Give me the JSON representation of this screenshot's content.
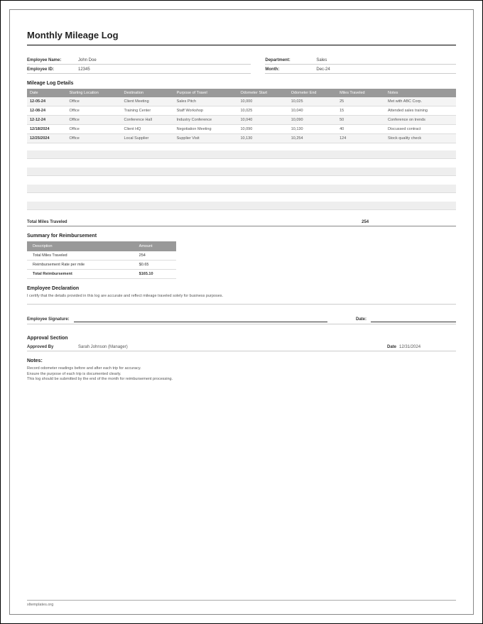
{
  "title": "Monthly Mileage Log",
  "info": {
    "employee_name_label": "Employee Name:",
    "employee_name": "John Doe",
    "department_label": "Department:",
    "department": "Sales",
    "employee_id_label": "Employee ID:",
    "employee_id": "12345",
    "month_label": "Month:",
    "month": "Dec-24"
  },
  "log_section_title": "Mileage Log Details",
  "log_headers": {
    "date": "Date",
    "start_loc": "Starting Location",
    "destination": "Destination",
    "purpose": "Purpose of Travel",
    "odo_start": "Odometer Start",
    "odo_end": "Odometer End",
    "miles": "Miles Traveled",
    "notes": "Notes"
  },
  "log_rows": [
    {
      "date": "12-05-24",
      "start": "Office",
      "dest": "Client Meeting",
      "purpose": "Sales Pitch",
      "ostart": "10,000",
      "oend": "10,025",
      "miles": "25",
      "notes": "Met with ABC Corp."
    },
    {
      "date": "12-08-24",
      "start": "Office",
      "dest": "Training Center",
      "purpose": "Staff Workshop",
      "ostart": "10,025",
      "oend": "10,040",
      "miles": "15",
      "notes": "Attended sales training"
    },
    {
      "date": "12-12-24",
      "start": "Office",
      "dest": "Conference Hall",
      "purpose": "Industry Conference",
      "ostart": "10,040",
      "oend": "10,090",
      "miles": "50",
      "notes": "Conference on trends"
    },
    {
      "date": "12/18/2024",
      "start": "Office",
      "dest": "Client HQ",
      "purpose": "Negotiation Meeting",
      "ostart": "10,090",
      "oend": "10,130",
      "miles": "40",
      "notes": "Discussed contract"
    },
    {
      "date": "12/25/2024",
      "start": "Office",
      "dest": "Local Supplier",
      "purpose": "Supplier Visit",
      "ostart": "10,130",
      "oend": "10,254",
      "miles": "124",
      "notes": "Stock quality check"
    }
  ],
  "total_label": "Total Miles Traveled",
  "total_value": "254",
  "summary_title": "Summary for Reimbursement",
  "summary_headers": {
    "desc": "Description",
    "amount": "Amount"
  },
  "summary_rows": [
    {
      "desc": "Total Miles Traveled",
      "amount": "254"
    },
    {
      "desc": "Reimbursement Rate per mile",
      "amount": "$0.65"
    }
  ],
  "summary_total": {
    "desc": "Total Reimbursement",
    "amount": "$165.10"
  },
  "declaration_title": "Employee Declaration",
  "declaration_text": "I certify that the details provided in this log are accurate and reflect mileage traveled solely for business purposes.",
  "signature": {
    "employee_label": "Employee Signature:",
    "date_label": "Date:"
  },
  "approval": {
    "section_title": "Approval Section",
    "approved_by_label": "Approved By",
    "approved_by": "Sarah Johnson (Manager)",
    "date_label": "Date",
    "date": "12/31/2024"
  },
  "notes_title": "Notes:",
  "notes": [
    "Record odometer readings before and after each trip for accuracy.",
    "Ensure the purpose of each trip is documented clearly.",
    "This log should be submitted by the end of the month for reimbursement processing."
  ],
  "footer": "xltemplates.org"
}
